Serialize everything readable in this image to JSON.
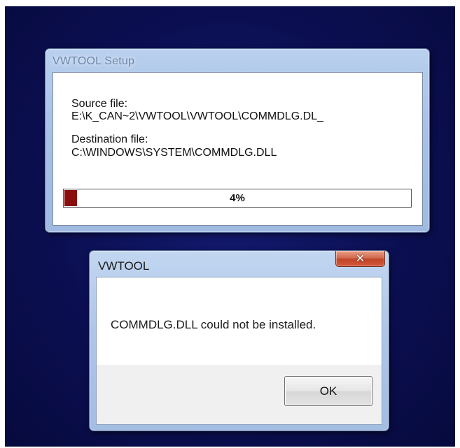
{
  "setup_window": {
    "title": "VWTOOL Setup",
    "source_label": "Source file:",
    "source_path": "E:\\K_CAN~2\\VWTOOL\\VWTOOL\\COMMDLG.DL_",
    "destination_label": "Destination file:",
    "destination_path": "C:\\WINDOWS\\SYSTEM\\COMMDLG.DLL",
    "progress": {
      "percent": 4,
      "label": "4%",
      "fill_color": "#8b0e0e"
    }
  },
  "error_dialog": {
    "title": "VWTOOL",
    "close_icon": "close-icon",
    "close_glyph": "✕",
    "message": "COMMDLG.DLL could not be installed.",
    "ok_label": "OK"
  },
  "colors": {
    "desktop_background": "#0b0f52",
    "window_frame": "#a8c2e6",
    "close_button": "#c0452a"
  }
}
